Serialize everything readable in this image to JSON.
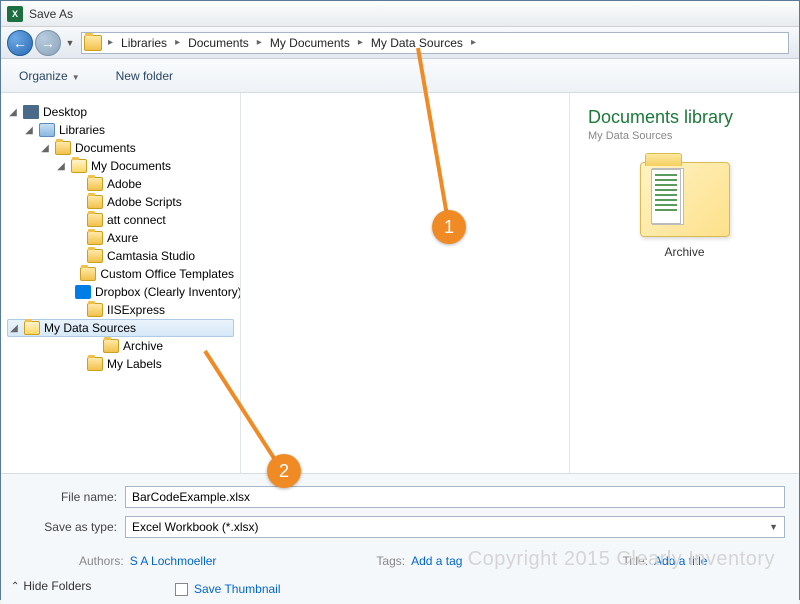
{
  "window": {
    "title": "Save As"
  },
  "breadcrumb": [
    "Libraries",
    "Documents",
    "My Documents",
    "My Data Sources"
  ],
  "toolbar": {
    "organize": "Organize",
    "new_folder": "New folder"
  },
  "tree": {
    "desktop": "Desktop",
    "libraries": "Libraries",
    "documents": "Documents",
    "my_documents": "My Documents",
    "items": [
      "Adobe",
      "Adobe Scripts",
      "att connect",
      "Axure",
      "Camtasia Studio",
      "Custom Office Templates",
      "Dropbox (Clearly Inventory)",
      "IISExpress",
      "My Data Sources",
      "Archive",
      "My Labels"
    ]
  },
  "library": {
    "title": "Documents library",
    "subtitle": "My Data Sources",
    "folder": "Archive"
  },
  "form": {
    "filename_label": "File name:",
    "filename": "BarCodeExample.xlsx",
    "saveas_label": "Save as type:",
    "saveas": "Excel Workbook (*.xlsx)"
  },
  "meta": {
    "authors_label": "Authors:",
    "authors": "S A Lochmoeller",
    "tags_label": "Tags:",
    "tags": "Add a tag",
    "title_label": "Title:",
    "title": "Add a title"
  },
  "thumb": "Save Thumbnail",
  "hide_folders": "Hide Folders",
  "watermark": "Copyright 2015 Clearly Inventory",
  "annotations": {
    "a1": "1",
    "a2": "2"
  }
}
